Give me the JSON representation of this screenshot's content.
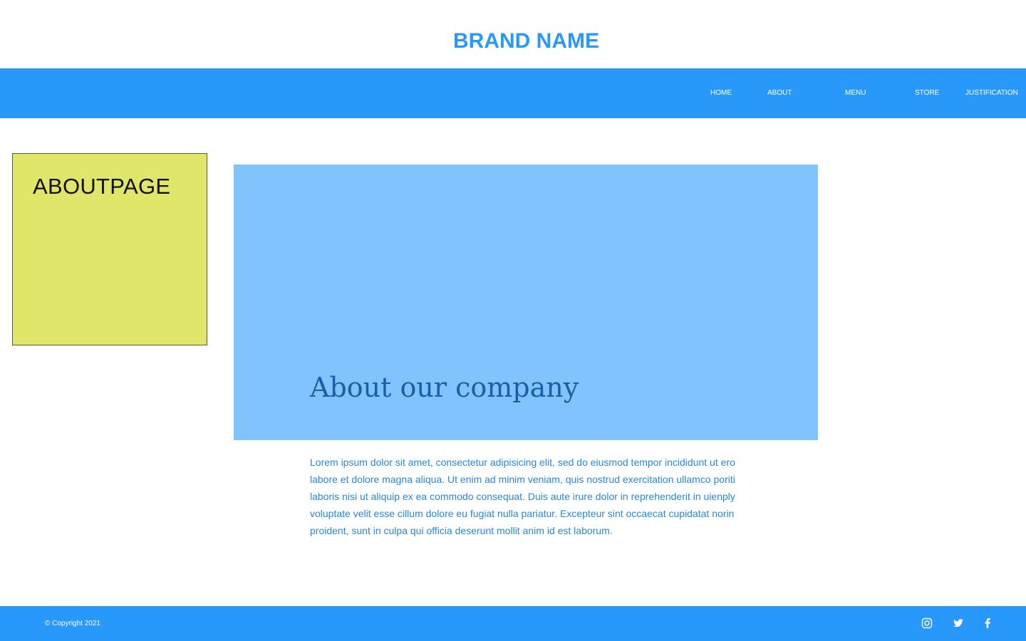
{
  "colors": {
    "brand_blue": "#2899FA",
    "nav_blue": "#2899FA",
    "hero_blue": "#7FC4FD",
    "hero_title": "#1B5EA8",
    "body_text": "#2787D8",
    "side_box": "#DFE66A",
    "white": "#FFFFFF"
  },
  "header": {
    "brand": "BRAND NAME"
  },
  "nav": {
    "items": [
      {
        "label": "HOME"
      },
      {
        "label": "ABOUT"
      },
      {
        "label": "MENU"
      },
      {
        "label": "STORE"
      },
      {
        "label": "JUSTIFICATION"
      }
    ]
  },
  "sidebar": {
    "title": "ABOUTPAGE"
  },
  "hero": {
    "title": "About our company"
  },
  "content": {
    "paragraph": "Lorem ipsum dolor sit amet, consectetur adipisicing elit, sed do eiusmod tempor incididunt ut ero labore et dolore magna aliqua. Ut enim ad minim veniam, quis nostrud exercitation ullamco poriti laboris nisi ut aliquip ex ea commodo consequat. Duis aute irure dolor in reprehenderit in uienply voluptate velit esse cillum dolore eu fugiat nulla pariatur. Excepteur sint occaecat cupidatat norin proident, sunt in culpa qui officia deserunt mollit anim id est laborum."
  },
  "footer": {
    "copyright": "© Copyright 2021",
    "social": [
      {
        "icon": "instagram-icon"
      },
      {
        "icon": "twitter-icon"
      },
      {
        "icon": "facebook-icon"
      }
    ]
  }
}
